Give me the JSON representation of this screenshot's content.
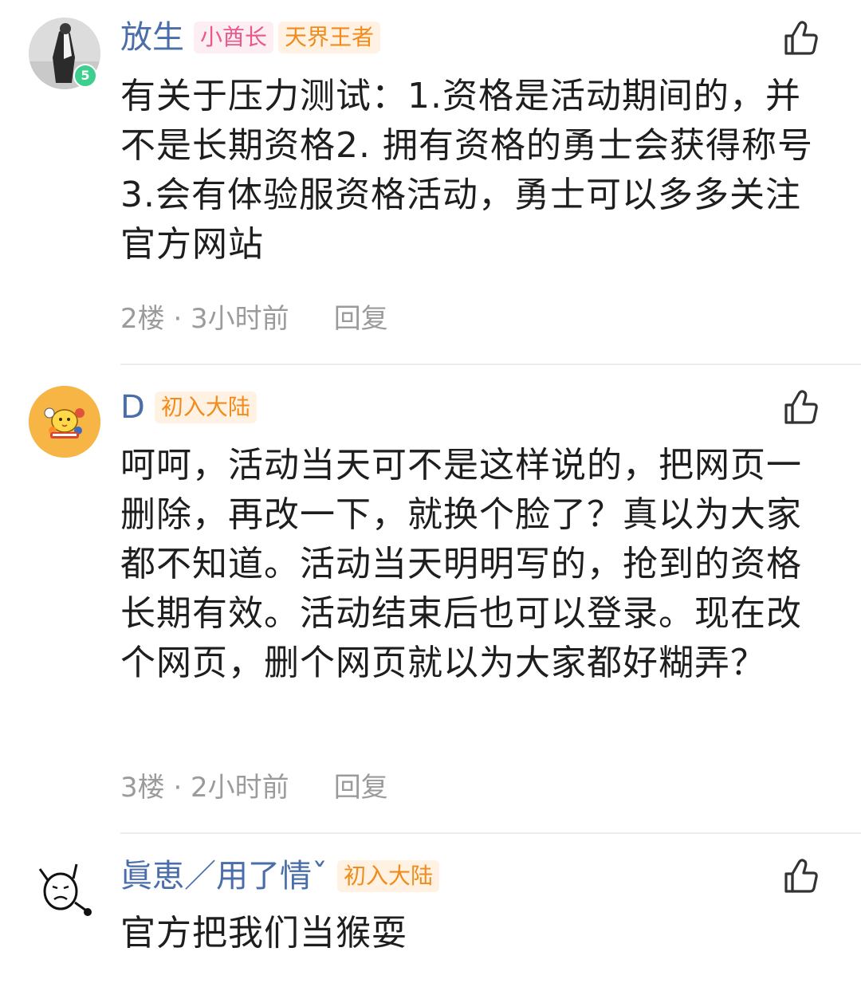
{
  "comments": [
    {
      "username": "放生",
      "badges": [
        "小酋长",
        "天界王者"
      ],
      "avatar_level": "5",
      "content": "有关于压力测试：1.资格是活动期间的，并不是长期资格2. 拥有资格的勇士会获得称号3.会有体验服资格活动，勇士可以多多关注官方网站",
      "floor_time": "2楼 · 3小时前",
      "reply_label": "回复"
    },
    {
      "username": "D",
      "badges": [
        "初入大陆"
      ],
      "content": "呵呵，活动当天可不是这样说的，把网页一删除，再改一下，就换个脸了？真以为大家都不知道。活动当天明明写的，抢到的资格长期有效。活动结束后也可以登录。现在改个网页，删个网页就以为大家都好糊弄？",
      "floor_time": "3楼 · 2小时前",
      "reply_label": "回复"
    },
    {
      "username": "眞恵／用了情ˇ",
      "badges": [
        "初入大陆"
      ],
      "content": "官方把我们当猴耍"
    }
  ],
  "colors": {
    "username": "#4a6ea9",
    "badge_pink_text": "#e8588a",
    "badge_orange_text": "#f08b1c",
    "meta_text": "#9b9b9b",
    "content_text": "#1e1e1e"
  },
  "icons": {
    "like": "thumbs-up-icon"
  }
}
